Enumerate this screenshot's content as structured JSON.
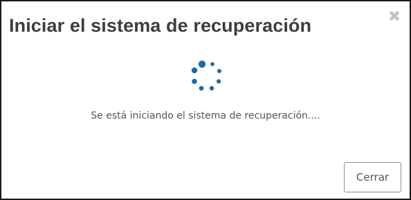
{
  "dialog": {
    "title": "Iniciar el sistema de recuperación",
    "close_glyph": "✖",
    "close_icon": "close-icon",
    "spinner_icon": "loading-spinner-icon",
    "spinner_color": "#1b6aaa",
    "message": "Se está iniciando el sistema de recuperación....",
    "close_button_label": "Cerrar"
  }
}
